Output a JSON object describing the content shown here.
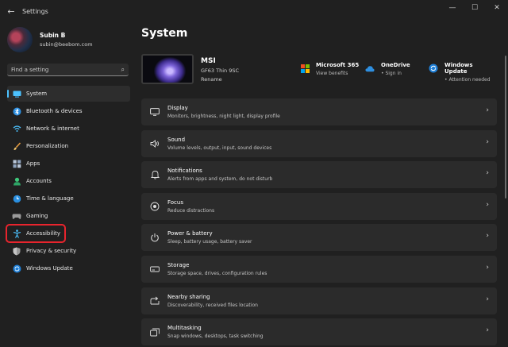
{
  "window": {
    "title": "Settings",
    "back_icon": "back-arrow-icon",
    "caption": {
      "minimize": "—",
      "maximize": "☐",
      "close": "✕"
    }
  },
  "profile": {
    "name": "Subin B",
    "email": "subin@beebom.com"
  },
  "search": {
    "placeholder": "Find a setting",
    "icon": "🔍"
  },
  "sidebar": {
    "items": [
      {
        "label": "System",
        "icon": "🖥",
        "color": "#4cc2ff",
        "selected": true
      },
      {
        "label": "Bluetooth & devices",
        "icon": "✱",
        "color": "#4cc2ff"
      },
      {
        "label": "Network & internet",
        "icon": "📶",
        "color": "#4cc2ff"
      },
      {
        "label": "Personalization",
        "icon": "🖌",
        "color": "#e59b3f"
      },
      {
        "label": "Apps",
        "icon": "▦",
        "color": "#a9b8cc"
      },
      {
        "label": "Accounts",
        "icon": "👤",
        "color": "#3ec87a"
      },
      {
        "label": "Time & language",
        "icon": "🌐",
        "color": "#4cc2ff"
      },
      {
        "label": "Gaming",
        "icon": "🎮",
        "color": "#a0a0a0"
      },
      {
        "label": "Accessibility",
        "icon": "♿",
        "color": "#4cc2ff",
        "highlighted": true
      },
      {
        "label": "Privacy & security",
        "icon": "🛡",
        "color": "#a0a0a0"
      },
      {
        "label": "Windows Update",
        "icon": "⟳",
        "color": "#4cc2ff"
      }
    ]
  },
  "main": {
    "title": "System",
    "device": {
      "name": "MSI",
      "model": "GF63 Thin 9SC",
      "rename": "Rename"
    },
    "quick_links": [
      {
        "title": "Microsoft 365",
        "subtitle": "View benefits"
      },
      {
        "title": "OneDrive",
        "subtitle": "• Sign in"
      },
      {
        "title": "Windows Update",
        "subtitle": "• Attention needed"
      }
    ],
    "cards": [
      {
        "title": "Display",
        "subtitle": "Monitors, brightness, night light, display profile",
        "icon": "▭"
      },
      {
        "title": "Sound",
        "subtitle": "Volume levels, output, input, sound devices",
        "icon": "🔈"
      },
      {
        "title": "Notifications",
        "subtitle": "Alerts from apps and system, do not disturb",
        "icon": "🔔"
      },
      {
        "title": "Focus",
        "subtitle": "Reduce distractions",
        "icon": "◎"
      },
      {
        "title": "Power & battery",
        "subtitle": "Sleep, battery usage, battery saver",
        "icon": "⏻"
      },
      {
        "title": "Storage",
        "subtitle": "Storage space, drives, configuration rules",
        "icon": "▬"
      },
      {
        "title": "Nearby sharing",
        "subtitle": "Discoverability, received files location",
        "icon": "⇪"
      },
      {
        "title": "Multitasking",
        "subtitle": "Snap windows, desktops, task switching",
        "icon": "⧉"
      }
    ]
  },
  "colors": {
    "accent": "#4cc2ff",
    "highlight_box": "#e8242d",
    "card_bg": "#2b2b2b"
  }
}
